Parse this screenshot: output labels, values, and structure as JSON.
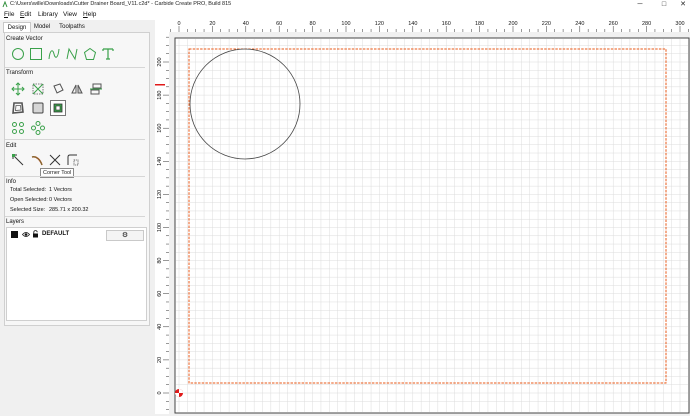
{
  "window": {
    "title": "C:\\Users\\wille\\Downloads\\Cutter Drainer Board_V11.c2d* - Carbide Create PRO, Build 815",
    "minimize": "─",
    "maximize": "□",
    "close": "✕"
  },
  "menu": [
    {
      "label": "File",
      "u": "F",
      "rest": "ile"
    },
    {
      "label": "Edit",
      "u": "E",
      "rest": "dit"
    },
    {
      "label": "Library",
      "u": "",
      "rest": "Library"
    },
    {
      "label": "View",
      "u": "",
      "rest": "View"
    },
    {
      "label": "Help",
      "u": "H",
      "rest": "elp"
    }
  ],
  "tabs": [
    "Design",
    "Model",
    "Toolpaths"
  ],
  "panel": {
    "create_vector": "Create Vector",
    "transform": "Transform",
    "edit": "Edit",
    "tooltip": "Corner Tool",
    "info": "Info",
    "info_rows": [
      {
        "label": "Total Selected:",
        "value": "1 Vectors"
      },
      {
        "label": "Open Selected:",
        "value": "0 Vectors"
      },
      {
        "label": "Selected Size:",
        "value": "285.71 x 200.32"
      }
    ],
    "layers": "Layers",
    "layer_name": "DEFAULT",
    "gear": "⚙"
  },
  "icons": {
    "create_vector": [
      "circle-tool-icon",
      "rectangle-tool-icon",
      "curve-tool-icon",
      "polyline-tool-icon",
      "polygon-tool-icon",
      "text-tool-icon"
    ],
    "transform_row1": [
      "move-icon",
      "scale-icon",
      "rotate-icon",
      "mirror-icon",
      "align-icon"
    ],
    "transform_row2": [
      "offset-icon",
      "boolean-icon",
      "join-icon"
    ],
    "transform_row3": [
      "array-icon",
      "circular-array-icon"
    ],
    "edit": [
      "node-edit-icon",
      "trim-icon",
      "cut-icon",
      "corner-tool-icon"
    ]
  },
  "rulers": {
    "x_labels": [
      "0",
      "20",
      "40",
      "60",
      "80",
      "100",
      "120",
      "140",
      "160",
      "180",
      "200",
      "220",
      "240",
      "260",
      "280",
      "300"
    ],
    "y_labels": [
      "200",
      "180",
      "160",
      "140",
      "120",
      "100",
      "80",
      "60",
      "40",
      "20",
      "0"
    ]
  },
  "colors": {
    "accent_green": "#3aa14a",
    "grid": "#dcdcdc",
    "stock_outline": "#e85a1a",
    "origin_red": "#e01a1a"
  }
}
